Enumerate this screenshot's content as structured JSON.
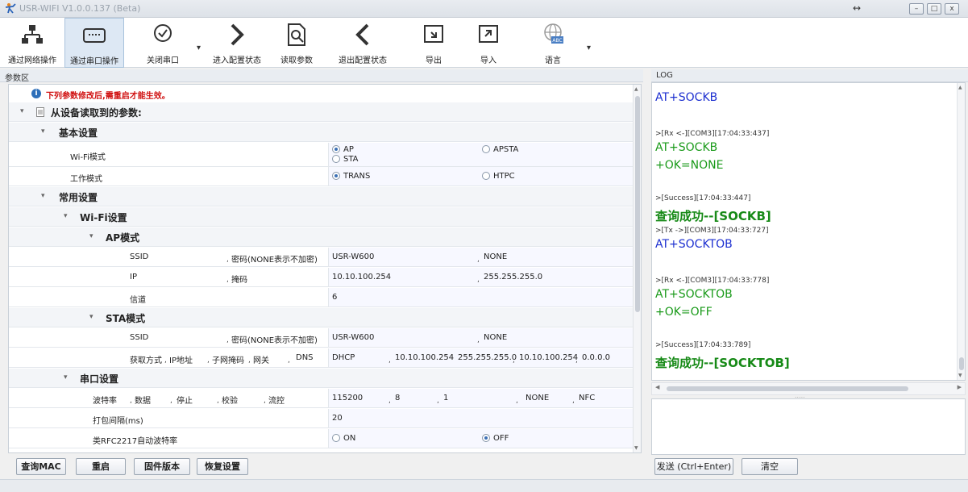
{
  "window": {
    "title": "USR-WIFI V1.0.0.137 (Beta)",
    "minimize": "–",
    "maximize": "□",
    "close": "x",
    "resize_arrows": "↔"
  },
  "toolbar": {
    "items": [
      {
        "label": "通过网络操作"
      },
      {
        "label": "通过串口操作"
      },
      {
        "label": "关闭串口"
      },
      {
        "label": "进入配置状态"
      },
      {
        "label": "读取参数"
      },
      {
        "label": "退出配置状态"
      },
      {
        "label": "导出"
      },
      {
        "label": "导入"
      },
      {
        "label": "语言"
      }
    ],
    "dropdown_marker": "▾",
    "language_badge": "ABC"
  },
  "params_panel": {
    "title": "参数区",
    "warning_icon": "i",
    "warning": "下列参数修改后,需重启才能生效。",
    "root": "从设备读取到的参数:",
    "basic": {
      "title": "基本设置",
      "wifi_mode_label": "Wi-Fi模式",
      "wifi_options": [
        "AP",
        "APSTA",
        "STA"
      ],
      "work_mode_label": "工作模式",
      "work_options": [
        "TRANS",
        "HTPC"
      ]
    },
    "common": {
      "title": "常用设置",
      "wifi_settings": "Wi-Fi设置",
      "ap_mode": {
        "title": "AP模式",
        "row1_labels": [
          "SSID",
          "密码(NONE表示不加密)"
        ],
        "row1_values": [
          "USR-W600",
          "NONE"
        ],
        "row2_labels": [
          "IP",
          "掩码"
        ],
        "row2_values": [
          "10.10.100.254",
          "255.255.255.0"
        ],
        "row3_label": "信道",
        "row3_value": "6"
      },
      "sta_mode": {
        "title": "STA模式",
        "row1_labels": [
          "SSID",
          "密码(NONE表示不加密)"
        ],
        "row1_values": [
          "USR-W600",
          "NONE"
        ],
        "row2_labels": [
          "获取方式",
          "IP地址",
          "子网掩码",
          "网关",
          "DNS"
        ],
        "row2_values": [
          "DHCP",
          "10.10.100.254",
          "255.255.255.0",
          "10.10.100.254",
          "0.0.0.0"
        ]
      }
    },
    "serial": {
      "title": "串口设置",
      "row1_labels": [
        "波特率",
        "数据",
        "停止",
        "校验",
        "流控"
      ],
      "row1_values": [
        "115200",
        "8",
        "1",
        "NONE",
        "NFC"
      ],
      "pack_interval_label": "打包间隔(ms)",
      "pack_interval_value": "20",
      "rfc_label": "类RFC2217自动波特率",
      "rfc_options": [
        "ON",
        "OFF"
      ]
    },
    "expander": "▾",
    "comma": ","
  },
  "bottom_buttons": {
    "query_mac": "查询MAC",
    "restart": "重启",
    "firmware": "固件版本",
    "restore": "恢复设置"
  },
  "log_panel": {
    "title": "LOG",
    "lines": [
      {
        "kind": "cmd",
        "text": "AT+SOCKB"
      },
      {
        "kind": "meta",
        "text": ">[Rx <-][COM3][17:04:33:437]"
      },
      {
        "kind": "resp",
        "text": "AT+SOCKB"
      },
      {
        "kind": "resp",
        "text": "+OK=NONE"
      },
      {
        "kind": "meta",
        "text": ">[Success][17:04:33:447]"
      },
      {
        "kind": "succ",
        "text": "查询成功--[SOCKB]"
      },
      {
        "kind": "meta",
        "text": ">[Tx ->][COM3][17:04:33:727]"
      },
      {
        "kind": "cmd",
        "text": "AT+SOCKTOB"
      },
      {
        "kind": "meta",
        "text": ">[Rx <-][COM3][17:04:33:778]"
      },
      {
        "kind": "resp",
        "text": "AT+SOCKTOB"
      },
      {
        "kind": "resp",
        "text": "+OK=OFF"
      },
      {
        "kind": "meta",
        "text": ">[Success][17:04:33:789]"
      },
      {
        "kind": "succ",
        "text": "查询成功--[SOCKTOB]"
      }
    ],
    "send_button": "发送 (Ctrl+Enter)",
    "clear_button": "清空",
    "splitter_grip": "....."
  }
}
